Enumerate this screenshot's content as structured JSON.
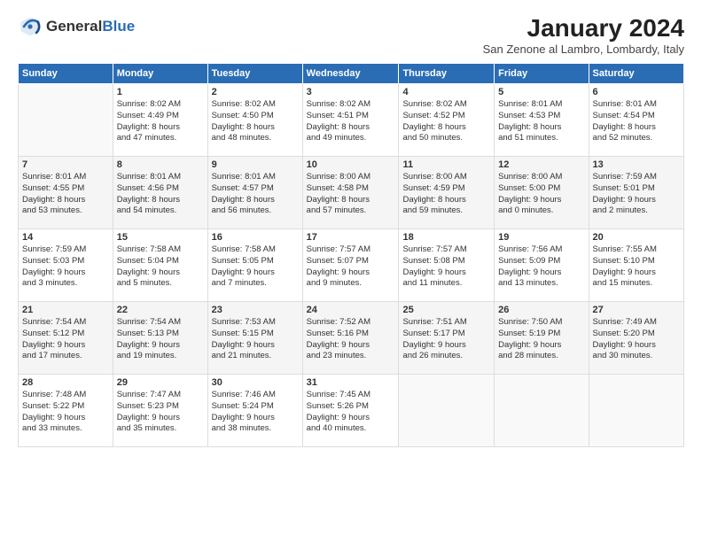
{
  "header": {
    "logo_general": "General",
    "logo_blue": "Blue",
    "month_title": "January 2024",
    "subtitle": "San Zenone al Lambro, Lombardy, Italy"
  },
  "days_of_week": [
    "Sunday",
    "Monday",
    "Tuesday",
    "Wednesday",
    "Thursday",
    "Friday",
    "Saturday"
  ],
  "weeks": [
    [
      {
        "day": "",
        "info": ""
      },
      {
        "day": "1",
        "info": "Sunrise: 8:02 AM\nSunset: 4:49 PM\nDaylight: 8 hours\nand 47 minutes."
      },
      {
        "day": "2",
        "info": "Sunrise: 8:02 AM\nSunset: 4:50 PM\nDaylight: 8 hours\nand 48 minutes."
      },
      {
        "day": "3",
        "info": "Sunrise: 8:02 AM\nSunset: 4:51 PM\nDaylight: 8 hours\nand 49 minutes."
      },
      {
        "day": "4",
        "info": "Sunrise: 8:02 AM\nSunset: 4:52 PM\nDaylight: 8 hours\nand 50 minutes."
      },
      {
        "day": "5",
        "info": "Sunrise: 8:01 AM\nSunset: 4:53 PM\nDaylight: 8 hours\nand 51 minutes."
      },
      {
        "day": "6",
        "info": "Sunrise: 8:01 AM\nSunset: 4:54 PM\nDaylight: 8 hours\nand 52 minutes."
      }
    ],
    [
      {
        "day": "7",
        "info": "Sunrise: 8:01 AM\nSunset: 4:55 PM\nDaylight: 8 hours\nand 53 minutes."
      },
      {
        "day": "8",
        "info": "Sunrise: 8:01 AM\nSunset: 4:56 PM\nDaylight: 8 hours\nand 54 minutes."
      },
      {
        "day": "9",
        "info": "Sunrise: 8:01 AM\nSunset: 4:57 PM\nDaylight: 8 hours\nand 56 minutes."
      },
      {
        "day": "10",
        "info": "Sunrise: 8:00 AM\nSunset: 4:58 PM\nDaylight: 8 hours\nand 57 minutes."
      },
      {
        "day": "11",
        "info": "Sunrise: 8:00 AM\nSunset: 4:59 PM\nDaylight: 8 hours\nand 59 minutes."
      },
      {
        "day": "12",
        "info": "Sunrise: 8:00 AM\nSunset: 5:00 PM\nDaylight: 9 hours\nand 0 minutes."
      },
      {
        "day": "13",
        "info": "Sunrise: 7:59 AM\nSunset: 5:01 PM\nDaylight: 9 hours\nand 2 minutes."
      }
    ],
    [
      {
        "day": "14",
        "info": "Sunrise: 7:59 AM\nSunset: 5:03 PM\nDaylight: 9 hours\nand 3 minutes."
      },
      {
        "day": "15",
        "info": "Sunrise: 7:58 AM\nSunset: 5:04 PM\nDaylight: 9 hours\nand 5 minutes."
      },
      {
        "day": "16",
        "info": "Sunrise: 7:58 AM\nSunset: 5:05 PM\nDaylight: 9 hours\nand 7 minutes."
      },
      {
        "day": "17",
        "info": "Sunrise: 7:57 AM\nSunset: 5:07 PM\nDaylight: 9 hours\nand 9 minutes."
      },
      {
        "day": "18",
        "info": "Sunrise: 7:57 AM\nSunset: 5:08 PM\nDaylight: 9 hours\nand 11 minutes."
      },
      {
        "day": "19",
        "info": "Sunrise: 7:56 AM\nSunset: 5:09 PM\nDaylight: 9 hours\nand 13 minutes."
      },
      {
        "day": "20",
        "info": "Sunrise: 7:55 AM\nSunset: 5:10 PM\nDaylight: 9 hours\nand 15 minutes."
      }
    ],
    [
      {
        "day": "21",
        "info": "Sunrise: 7:54 AM\nSunset: 5:12 PM\nDaylight: 9 hours\nand 17 minutes."
      },
      {
        "day": "22",
        "info": "Sunrise: 7:54 AM\nSunset: 5:13 PM\nDaylight: 9 hours\nand 19 minutes."
      },
      {
        "day": "23",
        "info": "Sunrise: 7:53 AM\nSunset: 5:15 PM\nDaylight: 9 hours\nand 21 minutes."
      },
      {
        "day": "24",
        "info": "Sunrise: 7:52 AM\nSunset: 5:16 PM\nDaylight: 9 hours\nand 23 minutes."
      },
      {
        "day": "25",
        "info": "Sunrise: 7:51 AM\nSunset: 5:17 PM\nDaylight: 9 hours\nand 26 minutes."
      },
      {
        "day": "26",
        "info": "Sunrise: 7:50 AM\nSunset: 5:19 PM\nDaylight: 9 hours\nand 28 minutes."
      },
      {
        "day": "27",
        "info": "Sunrise: 7:49 AM\nSunset: 5:20 PM\nDaylight: 9 hours\nand 30 minutes."
      }
    ],
    [
      {
        "day": "28",
        "info": "Sunrise: 7:48 AM\nSunset: 5:22 PM\nDaylight: 9 hours\nand 33 minutes."
      },
      {
        "day": "29",
        "info": "Sunrise: 7:47 AM\nSunset: 5:23 PM\nDaylight: 9 hours\nand 35 minutes."
      },
      {
        "day": "30",
        "info": "Sunrise: 7:46 AM\nSunset: 5:24 PM\nDaylight: 9 hours\nand 38 minutes."
      },
      {
        "day": "31",
        "info": "Sunrise: 7:45 AM\nSunset: 5:26 PM\nDaylight: 9 hours\nand 40 minutes."
      },
      {
        "day": "",
        "info": ""
      },
      {
        "day": "",
        "info": ""
      },
      {
        "day": "",
        "info": ""
      }
    ]
  ]
}
